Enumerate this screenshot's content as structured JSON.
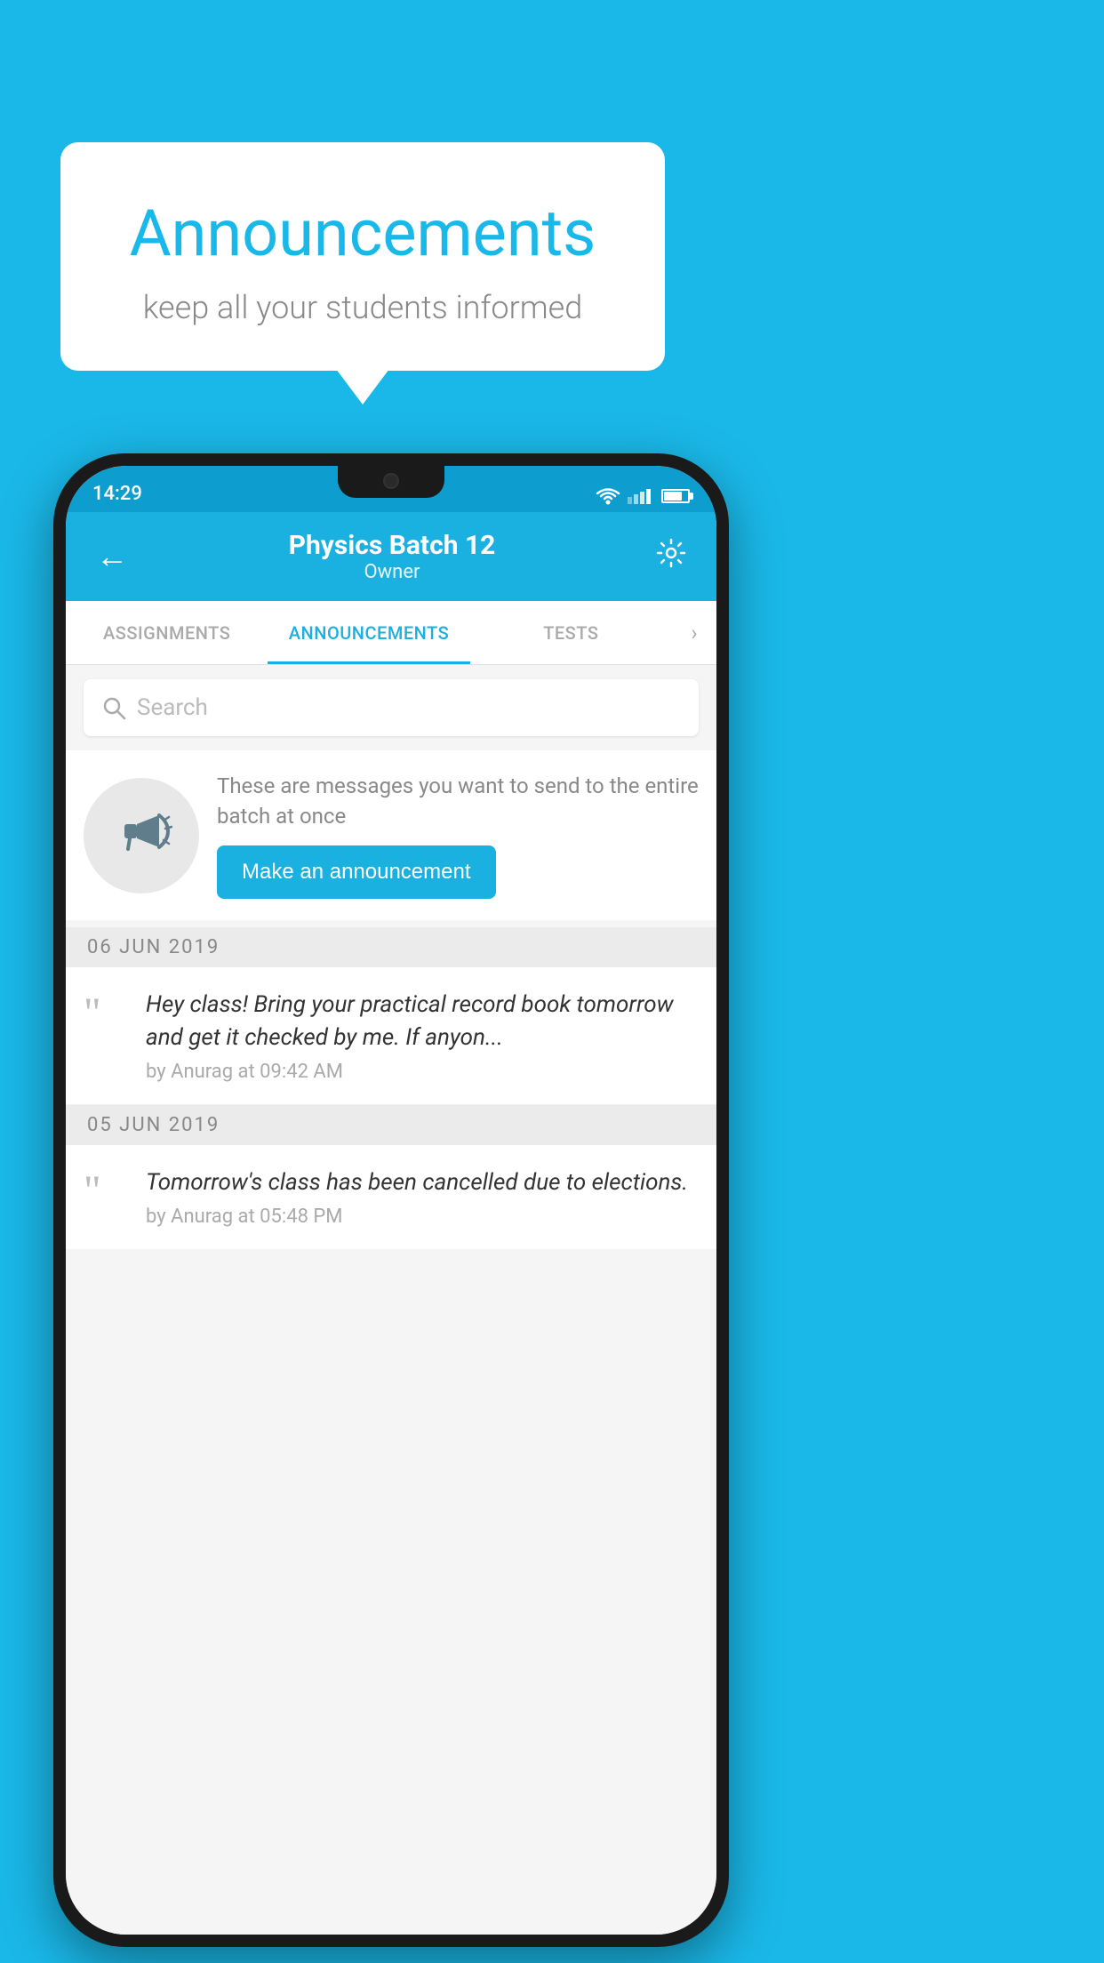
{
  "background_color": "#1ab8e8",
  "speech_bubble": {
    "title": "Announcements",
    "subtitle": "keep all your students informed"
  },
  "status_bar": {
    "time": "14:29",
    "icons": [
      "wifi",
      "signal",
      "battery"
    ]
  },
  "app_bar": {
    "title": "Physics Batch 12",
    "subtitle": "Owner",
    "back_label": "←",
    "settings_label": "⚙"
  },
  "tabs": [
    {
      "label": "ASSIGNMENTS",
      "active": false
    },
    {
      "label": "ANNOUNCEMENTS",
      "active": true
    },
    {
      "label": "TESTS",
      "active": false
    }
  ],
  "search": {
    "placeholder": "Search"
  },
  "announcement_cta": {
    "description_text": "These are messages you want to send to the entire batch at once",
    "button_label": "Make an announcement"
  },
  "announcements": [
    {
      "date": "06  JUN  2019",
      "text": "Hey class! Bring your practical record book tomorrow and get it checked by me. If anyon...",
      "meta": "by Anurag at 09:42 AM"
    },
    {
      "date": "05  JUN  2019",
      "text": "Tomorrow's class has been cancelled due to elections.",
      "meta": "by Anurag at 05:48 PM"
    }
  ]
}
